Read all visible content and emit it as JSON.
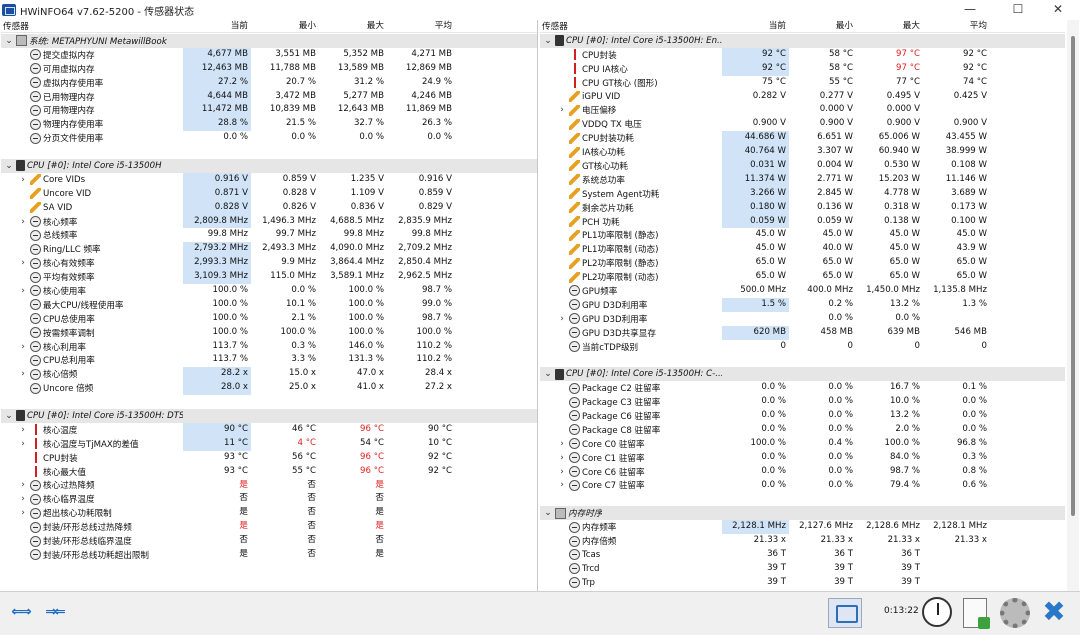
{
  "window": {
    "title": "HWiNFO64 v7.62-5200 - 传感器状态",
    "controls": {
      "minimize": "—",
      "maximize": "☐",
      "close": "✕"
    }
  },
  "columns": {
    "sensor": "传感器",
    "current": "当前",
    "min": "最小",
    "max": "最大",
    "avg": "平均"
  },
  "icons": {
    "clock": "clock-icon",
    "bolt": "lightning-bolt-icon",
    "therm": "thermometer-icon",
    "chip": "chip-icon",
    "cpu": "cpu-icon",
    "mem": "memory-icon"
  },
  "colors": {
    "highlight": "#d0e3f7",
    "alert_red": "#e02020",
    "group_bg": "#e6e6e6",
    "accent_blue": "#1a6cc4"
  },
  "left_pane": [
    {
      "type": "group",
      "exp": "⌄",
      "icon": "mem",
      "label": "系统: METAPHYUNI MetawillBook"
    },
    {
      "exp": "",
      "icon": "clock",
      "label": "提交虚拟内存",
      "cur": "4,677 MB",
      "min": "3,551 MB",
      "max": "5,352 MB",
      "avg": "4,271 MB",
      "hl": true
    },
    {
      "exp": "",
      "icon": "clock",
      "label": "可用虚拟内存",
      "cur": "12,463 MB",
      "min": "11,788 MB",
      "max": "13,589 MB",
      "avg": "12,869 MB",
      "hl": true
    },
    {
      "exp": "",
      "icon": "clock",
      "label": "虚拟内存使用率",
      "cur": "27.2 %",
      "min": "20.7 %",
      "max": "31.2 %",
      "avg": "24.9 %",
      "hl": true
    },
    {
      "exp": "",
      "icon": "clock",
      "label": "已用物理内存",
      "cur": "4,644 MB",
      "min": "3,472 MB",
      "max": "5,277 MB",
      "avg": "4,246 MB",
      "hl": true
    },
    {
      "exp": "",
      "icon": "clock",
      "label": "可用物理内存",
      "cur": "11,472 MB",
      "min": "10,839 MB",
      "max": "12,643 MB",
      "avg": "11,869 MB",
      "hl": true
    },
    {
      "exp": "",
      "icon": "clock",
      "label": "物理内存使用率",
      "cur": "28.8 %",
      "min": "21.5 %",
      "max": "32.7 %",
      "avg": "26.3 %",
      "hl": true
    },
    {
      "exp": "",
      "icon": "clock",
      "label": "分页文件使用率",
      "cur": "0.0 %",
      "min": "0.0 %",
      "max": "0.0 %",
      "avg": "0.0 %"
    },
    {
      "type": "gap"
    },
    {
      "type": "group",
      "exp": "⌄",
      "icon": "chip",
      "label": "CPU [#0]: Intel Core i5-13500H"
    },
    {
      "exp": "›",
      "icon": "bolt",
      "label": "Core VIDs",
      "cur": "0.916 V",
      "min": "0.859 V",
      "max": "1.235 V",
      "avg": "0.916 V",
      "hl": true
    },
    {
      "exp": "",
      "icon": "bolt",
      "label": "Uncore VID",
      "cur": "0.871 V",
      "min": "0.828 V",
      "max": "1.109 V",
      "avg": "0.859 V",
      "hl": true
    },
    {
      "exp": "",
      "icon": "bolt",
      "label": "SA VID",
      "cur": "0.828 V",
      "min": "0.826 V",
      "max": "0.836 V",
      "avg": "0.829 V",
      "hl": true
    },
    {
      "exp": "›",
      "icon": "clock",
      "label": "核心频率",
      "cur": "2,809.8 MHz",
      "min": "1,496.3 MHz",
      "max": "4,688.5 MHz",
      "avg": "2,835.9 MHz",
      "hl": true
    },
    {
      "exp": "",
      "icon": "clock",
      "label": "总线频率",
      "cur": "99.8 MHz",
      "min": "99.7 MHz",
      "max": "99.8 MHz",
      "avg": "99.8 MHz"
    },
    {
      "exp": "",
      "icon": "clock",
      "label": "Ring/LLC 频率",
      "cur": "2,793.2 MHz",
      "min": "2,493.3 MHz",
      "max": "4,090.0 MHz",
      "avg": "2,709.2 MHz",
      "hl": true
    },
    {
      "exp": "›",
      "icon": "clock",
      "label": "核心有效频率",
      "cur": "2,993.3 MHz",
      "min": "9.9 MHz",
      "max": "3,864.4 MHz",
      "avg": "2,850.4 MHz",
      "hl": true
    },
    {
      "exp": "",
      "icon": "clock",
      "label": "平均有效频率",
      "cur": "3,109.3 MHz",
      "min": "115.0 MHz",
      "max": "3,589.1 MHz",
      "avg": "2,962.5 MHz",
      "hl": true
    },
    {
      "exp": "›",
      "icon": "clock",
      "label": "核心使用率",
      "cur": "100.0 %",
      "min": "0.0 %",
      "max": "100.0 %",
      "avg": "98.7 %"
    },
    {
      "exp": "",
      "icon": "clock",
      "label": "最大CPU/线程使用率",
      "cur": "100.0 %",
      "min": "10.1 %",
      "max": "100.0 %",
      "avg": "99.0 %"
    },
    {
      "exp": "",
      "icon": "clock",
      "label": "CPU总使用率",
      "cur": "100.0 %",
      "min": "2.1 %",
      "max": "100.0 %",
      "avg": "98.7 %"
    },
    {
      "exp": "",
      "icon": "clock",
      "label": "按需频率调制",
      "cur": "100.0 %",
      "min": "100.0 %",
      "max": "100.0 %",
      "avg": "100.0 %"
    },
    {
      "exp": "›",
      "icon": "clock",
      "label": "核心利用率",
      "cur": "113.7 %",
      "min": "0.3 %",
      "max": "146.0 %",
      "avg": "110.2 %"
    },
    {
      "exp": "",
      "icon": "clock",
      "label": "CPU总利用率",
      "cur": "113.7 %",
      "min": "3.3 %",
      "max": "131.3 %",
      "avg": "110.2 %"
    },
    {
      "exp": "›",
      "icon": "clock",
      "label": "核心倍频",
      "cur": "28.2 x",
      "min": "15.0 x",
      "max": "47.0 x",
      "avg": "28.4 x",
      "hl": true
    },
    {
      "exp": "",
      "icon": "clock",
      "label": "Uncore 倍频",
      "cur": "28.0 x",
      "min": "25.0 x",
      "max": "41.0 x",
      "avg": "27.2 x",
      "hl": true
    },
    {
      "type": "gap"
    },
    {
      "type": "group",
      "exp": "⌄",
      "icon": "chip",
      "label": "CPU [#0]: Intel Core i5-13500H: DTS"
    },
    {
      "exp": "›",
      "icon": "therm",
      "label": "核心温度",
      "cur": "90 °C",
      "min": "46 °C",
      "max": "96 °C",
      "avg": "90 °C",
      "hl": true,
      "maxred": true
    },
    {
      "exp": "›",
      "icon": "therm",
      "label": "核心温度与TjMAX的差值",
      "cur": "11 °C",
      "min": "4 °C",
      "max": "54 °C",
      "avg": "10 °C",
      "hl": true,
      "minred": true
    },
    {
      "exp": "",
      "icon": "therm",
      "label": "CPU封装",
      "cur": "93 °C",
      "min": "56 °C",
      "max": "96 °C",
      "avg": "92 °C",
      "maxred": true
    },
    {
      "exp": "",
      "icon": "therm",
      "label": "核心最大值",
      "cur": "93 °C",
      "min": "55 °C",
      "max": "96 °C",
      "avg": "92 °C",
      "maxred": true
    },
    {
      "exp": "›",
      "icon": "clock",
      "label": "核心过热降频",
      "cur": "是",
      "min": "否",
      "max": "是",
      "avg": "",
      "curred": true,
      "maxred": true
    },
    {
      "exp": "›",
      "icon": "clock",
      "label": "核心临界温度",
      "cur": "否",
      "min": "否",
      "max": "否",
      "avg": ""
    },
    {
      "exp": "›",
      "icon": "clock",
      "label": "超出核心功耗限制",
      "cur": "是",
      "min": "否",
      "max": "是",
      "avg": ""
    },
    {
      "exp": "",
      "icon": "clock",
      "label": "封装/环形总线过热降频",
      "cur": "是",
      "min": "否",
      "max": "是",
      "avg": "",
      "curred": true,
      "maxred": true
    },
    {
      "exp": "",
      "icon": "clock",
      "label": "封装/环形总线临界温度",
      "cur": "否",
      "min": "否",
      "max": "否",
      "avg": ""
    },
    {
      "exp": "",
      "icon": "clock",
      "label": "封装/环形总线功耗超出限制",
      "cur": "是",
      "min": "否",
      "max": "是",
      "avg": ""
    }
  ],
  "right_pane": [
    {
      "type": "group",
      "exp": "⌄",
      "icon": "chip",
      "label": "CPU [#0]: Intel Core i5-13500H: En..."
    },
    {
      "exp": "",
      "icon": "therm",
      "label": "CPU封装",
      "cur": "92 °C",
      "min": "58 °C",
      "max": "97 °C",
      "avg": "92 °C",
      "hl": true,
      "maxred": true
    },
    {
      "exp": "",
      "icon": "therm",
      "label": "CPU IA核心",
      "cur": "92 °C",
      "min": "58 °C",
      "max": "97 °C",
      "avg": "92 °C",
      "hl": true,
      "maxred": true
    },
    {
      "exp": "",
      "icon": "therm",
      "label": "CPU GT核心 (图形)",
      "cur": "75 °C",
      "min": "55 °C",
      "max": "77 °C",
      "avg": "74 °C"
    },
    {
      "exp": "",
      "icon": "bolt",
      "label": "iGPU VID",
      "cur": "0.282 V",
      "min": "0.277 V",
      "max": "0.495 V",
      "avg": "0.425 V"
    },
    {
      "exp": "›",
      "icon": "bolt",
      "label": "电压偏移",
      "cur": "",
      "min": "0.000 V",
      "max": "0.000 V",
      "avg": ""
    },
    {
      "exp": "",
      "icon": "bolt",
      "label": "VDDQ TX 电压",
      "cur": "0.900 V",
      "min": "0.900 V",
      "max": "0.900 V",
      "avg": "0.900 V"
    },
    {
      "exp": "",
      "icon": "bolt",
      "label": "CPU封装功耗",
      "cur": "44.686 W",
      "min": "6.651 W",
      "max": "65.006 W",
      "avg": "43.455 W",
      "hl": true
    },
    {
      "exp": "",
      "icon": "bolt",
      "label": "IA核心功耗",
      "cur": "40.764 W",
      "min": "3.307 W",
      "max": "60.940 W",
      "avg": "38.999 W",
      "hl": true
    },
    {
      "exp": "",
      "icon": "bolt",
      "label": "GT核心功耗",
      "cur": "0.031 W",
      "min": "0.004 W",
      "max": "0.530 W",
      "avg": "0.108 W",
      "hl": true
    },
    {
      "exp": "",
      "icon": "bolt",
      "label": "系统总功率",
      "cur": "11.374 W",
      "min": "2.771 W",
      "max": "15.203 W",
      "avg": "11.146 W",
      "hl": true
    },
    {
      "exp": "",
      "icon": "bolt",
      "label": "System Agent功耗",
      "cur": "3.266 W",
      "min": "2.845 W",
      "max": "4.778 W",
      "avg": "3.689 W",
      "hl": true
    },
    {
      "exp": "",
      "icon": "bolt",
      "label": "剩余芯片功耗",
      "cur": "0.180 W",
      "min": "0.136 W",
      "max": "0.318 W",
      "avg": "0.173 W",
      "hl": true
    },
    {
      "exp": "",
      "icon": "bolt",
      "label": "PCH 功耗",
      "cur": "0.059 W",
      "min": "0.059 W",
      "max": "0.138 W",
      "avg": "0.100 W",
      "hl": true
    },
    {
      "exp": "",
      "icon": "bolt",
      "label": "PL1功率限制 (静态)",
      "cur": "45.0 W",
      "min": "45.0 W",
      "max": "45.0 W",
      "avg": "45.0 W"
    },
    {
      "exp": "",
      "icon": "bolt",
      "label": "PL1功率限制 (动态)",
      "cur": "45.0 W",
      "min": "40.0 W",
      "max": "45.0 W",
      "avg": "43.9 W"
    },
    {
      "exp": "",
      "icon": "bolt",
      "label": "PL2功率限制 (静态)",
      "cur": "65.0 W",
      "min": "65.0 W",
      "max": "65.0 W",
      "avg": "65.0 W"
    },
    {
      "exp": "",
      "icon": "bolt",
      "label": "PL2功率限制 (动态)",
      "cur": "65.0 W",
      "min": "65.0 W",
      "max": "65.0 W",
      "avg": "65.0 W"
    },
    {
      "exp": "",
      "icon": "clock",
      "label": "GPU频率",
      "cur": "500.0 MHz",
      "min": "400.0 MHz",
      "max": "1,450.0 MHz",
      "avg": "1,135.8 MHz"
    },
    {
      "exp": "",
      "icon": "clock",
      "label": "GPU D3D利用率",
      "cur": "1.5 %",
      "min": "0.2 %",
      "max": "13.2 %",
      "avg": "1.3 %",
      "hl": true
    },
    {
      "exp": "›",
      "icon": "clock",
      "label": "GPU D3D利用率",
      "cur": "",
      "min": "0.0 %",
      "max": "0.0 %",
      "avg": ""
    },
    {
      "exp": "",
      "icon": "clock",
      "label": "GPU D3D共享显存",
      "cur": "620 MB",
      "min": "458 MB",
      "max": "639 MB",
      "avg": "546 MB",
      "hl": true
    },
    {
      "exp": "",
      "icon": "clock",
      "label": "当前cTDP级别",
      "cur": "0",
      "min": "0",
      "max": "0",
      "avg": "0"
    },
    {
      "type": "gap"
    },
    {
      "type": "group",
      "exp": "⌄",
      "icon": "chip",
      "label": "CPU [#0]: Intel Core i5-13500H: C-..."
    },
    {
      "exp": "",
      "icon": "clock",
      "label": "Package C2 驻留率",
      "cur": "0.0 %",
      "min": "0.0 %",
      "max": "16.7 %",
      "avg": "0.1 %"
    },
    {
      "exp": "",
      "icon": "clock",
      "label": "Package C3 驻留率",
      "cur": "0.0 %",
      "min": "0.0 %",
      "max": "10.0 %",
      "avg": "0.0 %"
    },
    {
      "exp": "",
      "icon": "clock",
      "label": "Package C6 驻留率",
      "cur": "0.0 %",
      "min": "0.0 %",
      "max": "13.2 %",
      "avg": "0.0 %"
    },
    {
      "exp": "",
      "icon": "clock",
      "label": "Package C8 驻留率",
      "cur": "0.0 %",
      "min": "0.0 %",
      "max": "2.0 %",
      "avg": "0.0 %"
    },
    {
      "exp": "›",
      "icon": "clock",
      "label": "Core C0 驻留率",
      "cur": "100.0 %",
      "min": "0.4 %",
      "max": "100.0 %",
      "avg": "96.8 %"
    },
    {
      "exp": "›",
      "icon": "clock",
      "label": "Core C1 驻留率",
      "cur": "0.0 %",
      "min": "0.0 %",
      "max": "84.0 %",
      "avg": "0.3 %"
    },
    {
      "exp": "›",
      "icon": "clock",
      "label": "Core C6 驻留率",
      "cur": "0.0 %",
      "min": "0.0 %",
      "max": "98.7 %",
      "avg": "0.8 %"
    },
    {
      "exp": "›",
      "icon": "clock",
      "label": "Core C7 驻留率",
      "cur": "0.0 %",
      "min": "0.0 %",
      "max": "79.4 %",
      "avg": "0.6 %"
    },
    {
      "type": "gap"
    },
    {
      "type": "group",
      "exp": "⌄",
      "icon": "mem",
      "label": "内存时序"
    },
    {
      "exp": "",
      "icon": "clock",
      "label": "内存频率",
      "cur": "2,128.1 MHz",
      "min": "2,127.6 MHz",
      "max": "2,128.6 MHz",
      "avg": "2,128.1 MHz",
      "hl": true
    },
    {
      "exp": "",
      "icon": "clock",
      "label": "内存倍频",
      "cur": "21.33 x",
      "min": "21.33 x",
      "max": "21.33 x",
      "avg": "21.33 x"
    },
    {
      "exp": "",
      "icon": "clock",
      "label": "Tcas",
      "cur": "36 T",
      "min": "36 T",
      "max": "36 T",
      "avg": ""
    },
    {
      "exp": "",
      "icon": "clock",
      "label": "Trcd",
      "cur": "39 T",
      "min": "39 T",
      "max": "39 T",
      "avg": ""
    },
    {
      "exp": "",
      "icon": "clock",
      "label": "Trp",
      "cur": "39 T",
      "min": "39 T",
      "max": "39 T",
      "avg": ""
    }
  ],
  "toolbar": {
    "nav_left_glyph": "⇐⇒",
    "nav_right_glyph": "⇒⇐",
    "elapsed": "0:13:22",
    "close_glyph": "✖"
  }
}
